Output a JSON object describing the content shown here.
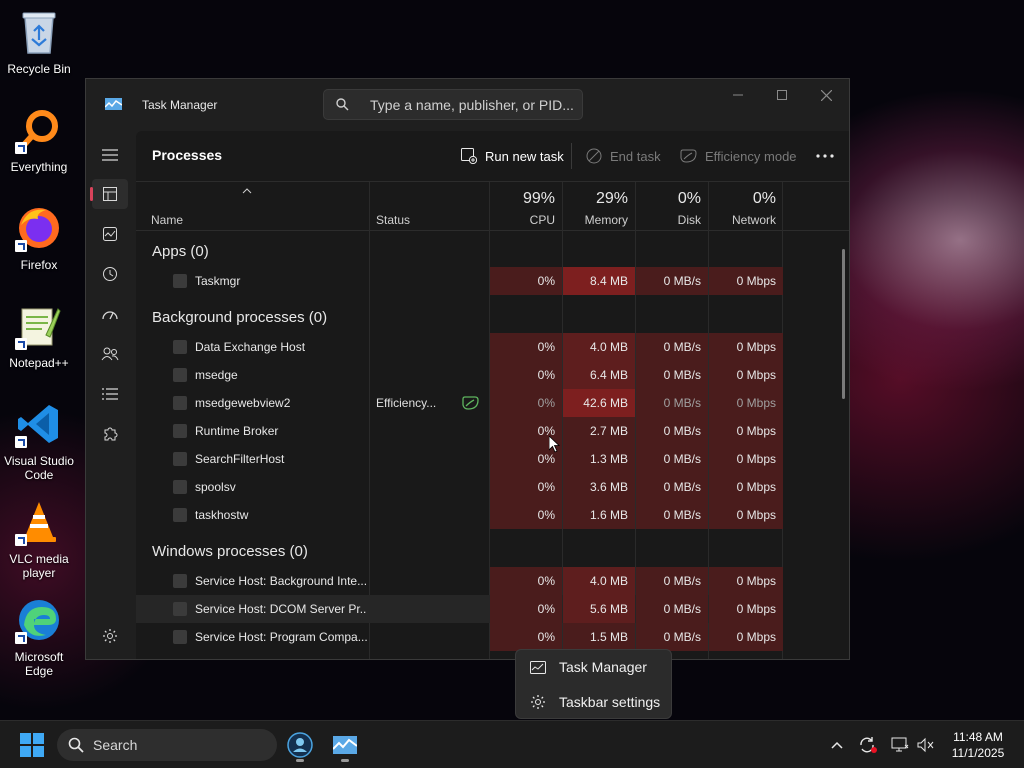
{
  "desktop": {
    "icons": [
      {
        "label": "Recycle Bin",
        "icon": "recycle-bin-icon"
      },
      {
        "label": "Everything",
        "icon": "everything-icon"
      },
      {
        "label": "Firefox",
        "icon": "firefox-icon"
      },
      {
        "label": "Notepad++",
        "icon": "notepadpp-icon"
      },
      {
        "label": "Visual Studio Code",
        "icon": "vscode-icon"
      },
      {
        "label": "VLC media player",
        "icon": "vlc-icon"
      },
      {
        "label": "Microsoft Edge",
        "icon": "edge-icon"
      }
    ]
  },
  "window": {
    "title": "Task Manager",
    "search_placeholder": "Type a name, publisher, or PID..."
  },
  "toolbar": {
    "page_title": "Processes",
    "run_new_task": "Run new task",
    "end_task": "End task",
    "efficiency_mode": "Efficiency mode"
  },
  "columns": {
    "name": "Name",
    "status": "Status",
    "cpu": {
      "pct": "99%",
      "label": "CPU"
    },
    "memory": {
      "pct": "29%",
      "label": "Memory"
    },
    "disk": {
      "pct": "0%",
      "label": "Disk"
    },
    "network": {
      "pct": "0%",
      "label": "Network"
    }
  },
  "groups": {
    "apps": "Apps (0)",
    "background": "Background processes (0)",
    "windows": "Windows processes (0)"
  },
  "processes": {
    "apps": [
      {
        "name": "Taskmgr",
        "status": "",
        "cpu": "0%",
        "mem": "8.4 MB",
        "disk": "0 MB/s",
        "net": "0 Mbps"
      }
    ],
    "background": [
      {
        "name": "Data Exchange Host",
        "status": "",
        "cpu": "0%",
        "mem": "4.0 MB",
        "disk": "0 MB/s",
        "net": "0 Mbps"
      },
      {
        "name": "msedge",
        "status": "",
        "cpu": "0%",
        "mem": "6.4 MB",
        "disk": "0 MB/s",
        "net": "0 Mbps"
      },
      {
        "name": "msedgewebview2",
        "status": "Efficiency...",
        "cpu": "0%",
        "mem": "42.6 MB",
        "disk": "0 MB/s",
        "net": "0 Mbps"
      },
      {
        "name": "Runtime Broker",
        "status": "",
        "cpu": "0%",
        "mem": "2.7 MB",
        "disk": "0 MB/s",
        "net": "0 Mbps"
      },
      {
        "name": "SearchFilterHost",
        "status": "",
        "cpu": "0%",
        "mem": "1.3 MB",
        "disk": "0 MB/s",
        "net": "0 Mbps"
      },
      {
        "name": "spoolsv",
        "status": "",
        "cpu": "0%",
        "mem": "3.6 MB",
        "disk": "0 MB/s",
        "net": "0 Mbps"
      },
      {
        "name": "taskhostw",
        "status": "",
        "cpu": "0%",
        "mem": "1.6 MB",
        "disk": "0 MB/s",
        "net": "0 Mbps"
      }
    ],
    "windows": [
      {
        "name": "Service Host: Background Inte...",
        "status": "",
        "cpu": "0%",
        "mem": "4.0 MB",
        "disk": "0 MB/s",
        "net": "0 Mbps"
      },
      {
        "name": "Service Host: DCOM Server Pr...",
        "status": "",
        "cpu": "0%",
        "mem": "5.6 MB",
        "disk": "0 MB/s",
        "net": "0 Mbps"
      },
      {
        "name": "Service Host: Program Compa...",
        "status": "",
        "cpu": "0%",
        "mem": "1.5 MB",
        "disk": "0 MB/s",
        "net": "0 Mbps"
      }
    ]
  },
  "context_menu": {
    "task_manager": "Task Manager",
    "taskbar_settings": "Taskbar settings"
  },
  "taskbar": {
    "search_label": "Search",
    "time": "11:48 AM",
    "date": "11/1/2025"
  },
  "colors": {
    "accent": "#d9435b",
    "heat_low": "#4a1c1c",
    "heat_mid": "#5e1e1e",
    "heat_high": "#7d1f1f",
    "efficiency_leaf": "#5fb55f"
  }
}
